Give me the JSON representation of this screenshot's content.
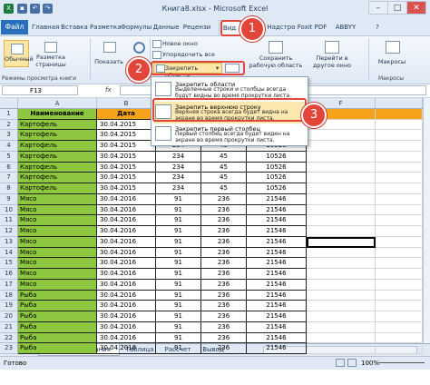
{
  "window": {
    "title": "Книга8.xlsx - Microsoft Excel",
    "file_icon": "excel-icon"
  },
  "tabs": [
    "Файл",
    "Главная",
    "Вставка",
    "Разметка",
    "Формулы",
    "Данные",
    "Рецензи",
    "Вид",
    "Надстро",
    "Foxit PDF",
    "ABBYY PDF"
  ],
  "ribbon": {
    "normal_label": "Обычный",
    "page_layout_label": "Разметка страницы",
    "show_label": "Показать",
    "zoom_label": "Масштаб",
    "new_window_label": "Новое окно",
    "arrange_all_label": "Упорядочить все",
    "freeze_label": "Закрепить области",
    "save_workspace_label": "Сохранить рабочую область",
    "switch_window_label": "Перейти в другое окно",
    "macros_label": "Макросы",
    "group_views_label": "Режимы просмотра книги",
    "group_macros_label": "Макросы"
  },
  "formula_bar": {
    "name_box": "F13",
    "fx": "fx"
  },
  "dropdown": [
    {
      "title": "Закрепить области",
      "desc": "Выделенные строки и столбцы всегда будут видны во время прокрутки листа."
    },
    {
      "title": "Закрепить верхнюю строку",
      "desc": "Верхняя строка всегда будет видна на экране во время прокрутки листа."
    },
    {
      "title": "Закрепить первый столбец",
      "desc": "Первый столбец всегда будет виден на экране во время прокрутки листа."
    }
  ],
  "callouts": [
    "1",
    "2",
    "3"
  ],
  "columns": [
    "A",
    "B",
    "C",
    "D",
    "E",
    "F"
  ],
  "header_row": [
    "Наименование",
    "Дата",
    "",
    "",
    "",
    ""
  ],
  "rows": [
    [
      "Картофель",
      "30.04.2015",
      "",
      "",
      "",
      ""
    ],
    [
      "Картофель",
      "30.04.2015",
      "",
      "",
      "",
      ""
    ],
    [
      "Картофель",
      "30.04.2015",
      "234",
      "45",
      "10526",
      ""
    ],
    [
      "Картофель",
      "30.04.2015",
      "234",
      "45",
      "10526",
      ""
    ],
    [
      "Картофель",
      "30.04.2015",
      "234",
      "45",
      "10526",
      ""
    ],
    [
      "Картофель",
      "30.04.2015",
      "234",
      "45",
      "10526",
      ""
    ],
    [
      "Картофель",
      "30.04.2015",
      "234",
      "45",
      "10526",
      ""
    ],
    [
      "Мясо",
      "30.04.2016",
      "91",
      "236",
      "21546",
      ""
    ],
    [
      "Мясо",
      "30.04.2016",
      "91",
      "236",
      "21546",
      ""
    ],
    [
      "Мясо",
      "30.04.2016",
      "91",
      "236",
      "21546",
      ""
    ],
    [
      "Мясо",
      "30.04.2016",
      "91",
      "236",
      "21546",
      ""
    ],
    [
      "Мясо",
      "30.04.2016",
      "91",
      "236",
      "21546",
      ""
    ],
    [
      "Мясо",
      "30.04.2016",
      "91",
      "236",
      "21546",
      ""
    ],
    [
      "Мясо",
      "30.04.2016",
      "91",
      "236",
      "21546",
      ""
    ],
    [
      "Мясо",
      "30.04.2016",
      "91",
      "236",
      "21546",
      ""
    ],
    [
      "Мясо",
      "30.04.2016",
      "91",
      "236",
      "21546",
      ""
    ],
    [
      "Рыба",
      "30.04.2016",
      "91",
      "236",
      "21546",
      ""
    ],
    [
      "Рыба",
      "30.04.2016",
      "91",
      "236",
      "21546",
      ""
    ],
    [
      "Рыба",
      "30.04.2016",
      "91",
      "236",
      "21546",
      ""
    ],
    [
      "Рыба",
      "30.04.2016",
      "91",
      "236",
      "21546",
      ""
    ],
    [
      "Рыба",
      "30.04.2016",
      "91",
      "236",
      "21546",
      ""
    ],
    [
      "Рыба",
      "30.04.2016",
      "91",
      "236",
      "21546",
      ""
    ]
  ],
  "row_numbers": [
    "1",
    "2",
    "3",
    "4",
    "5",
    "6",
    "7",
    "8",
    "9",
    "10",
    "11",
    "12",
    "13",
    "14",
    "15",
    "16",
    "17",
    "18",
    "19",
    "20",
    "21",
    "22",
    "23"
  ],
  "sheet_tabs": [
    "Продукты питания",
    "Таблица",
    "Рассчет",
    "Вывод"
  ],
  "status": {
    "ready": "Готово",
    "zoom": "100%"
  },
  "colors": {
    "accent_red": "#e2453a",
    "green_col": "#8dc63f",
    "orange_header": "#f7a21b",
    "file_tab": "#2a6fbd"
  }
}
